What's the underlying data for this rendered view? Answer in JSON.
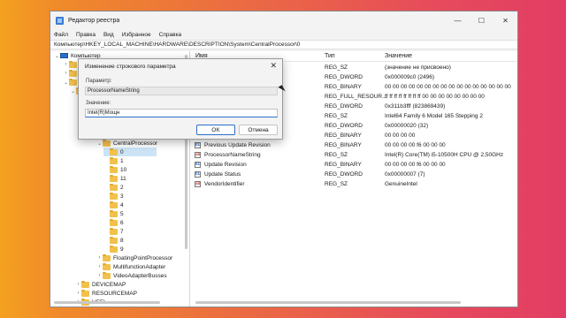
{
  "window": {
    "title": "Редактор реестра",
    "controls": [
      "—",
      "☐",
      "✕"
    ]
  },
  "menu": [
    "Файл",
    "Правка",
    "Вид",
    "Избранное",
    "Справка"
  ],
  "address": "Компьютер\\HKEY_LOCAL_MACHINE\\HARDWARE\\DESCRIPTION\\System\\CentralProcessor\\0",
  "tree": {
    "root": "Компьютер",
    "items": [
      {
        "label": "CentralProcessor",
        "chev": "⌄"
      },
      {
        "label": "0",
        "chev": "",
        "selected": true
      },
      {
        "label": "1",
        "chev": ""
      },
      {
        "label": "10",
        "chev": ""
      },
      {
        "label": "11",
        "chev": ""
      },
      {
        "label": "2",
        "chev": ""
      },
      {
        "label": "3",
        "chev": ""
      },
      {
        "label": "4",
        "chev": ""
      },
      {
        "label": "5",
        "chev": ""
      },
      {
        "label": "6",
        "chev": ""
      },
      {
        "label": "7",
        "chev": ""
      },
      {
        "label": "8",
        "chev": ""
      },
      {
        "label": "9",
        "chev": ""
      },
      {
        "label": "FloatingPointProcessor",
        "chev": "›"
      },
      {
        "label": "MultifunctionAdapter",
        "chev": "›"
      },
      {
        "label": "VideoAdapterBusses",
        "chev": "›"
      },
      {
        "label": "DEVICEMAP",
        "chev": "›"
      },
      {
        "label": "RESOURCEMAP",
        "chev": "›"
      },
      {
        "label": "UEFI",
        "chev": "›"
      }
    ]
  },
  "columns": {
    "name": "Имя",
    "type": "Тип",
    "data": "Значение"
  },
  "rows": [
    {
      "name": "",
      "type": "REG_SZ",
      "data": "(значение не присвоено)",
      "icon": "str"
    },
    {
      "name": "",
      "type": "REG_DWORD",
      "data": "0x000009c0 (2496)",
      "icon": "bin"
    },
    {
      "name": "",
      "type": "REG_BINARY",
      "data": "00 00 00 00 00 00 00 00 00 00 00 00 00 00 00 00",
      "icon": "bin"
    },
    {
      "name": "",
      "type": "REG_FULL_RESOUR...",
      "data": "ff ff ff ff ff ff ff ff 00 00 00 00 00 00 00 00",
      "icon": "bin"
    },
    {
      "name": "",
      "type": "REG_DWORD",
      "data": "0x311b3fff (823869439)",
      "icon": "bin"
    },
    {
      "name": "",
      "type": "REG_SZ",
      "data": "Intel64 Family 6 Model 165 Stepping 2",
      "icon": "str"
    },
    {
      "name": "",
      "type": "REG_DWORD",
      "data": "0x00000020 (32)",
      "icon": "bin"
    },
    {
      "name": "",
      "type": "REG_BINARY",
      "data": "00 00 00 00",
      "icon": "bin"
    },
    {
      "name": "Previous Update Revision",
      "type": "REG_BINARY",
      "data": "00 00 00 00 f6 00 00 00",
      "icon": "bin"
    },
    {
      "name": "ProcessorNameString",
      "type": "REG_SZ",
      "data": "Intel(R) Core(TM) i5-10500H CPU @ 2,50GHz",
      "icon": "str"
    },
    {
      "name": "Update Revision",
      "type": "REG_BINARY",
      "data": "00 00 00 00 f6 00 00 00",
      "icon": "bin"
    },
    {
      "name": "Update Status",
      "type": "REG_DWORD",
      "data": "0x00000007 (7)",
      "icon": "bin"
    },
    {
      "name": "VendorIdentifier",
      "type": "REG_SZ",
      "data": "GenuineIntel",
      "icon": "str"
    }
  ],
  "dialog": {
    "title": "Изменение строкового параметра",
    "param_label": "Параметр:",
    "param_value": "ProcessorNameString",
    "value_label": "Значение:",
    "value_text": "Intel(R)Мощн",
    "ok": "OK",
    "cancel": "Отмена"
  }
}
